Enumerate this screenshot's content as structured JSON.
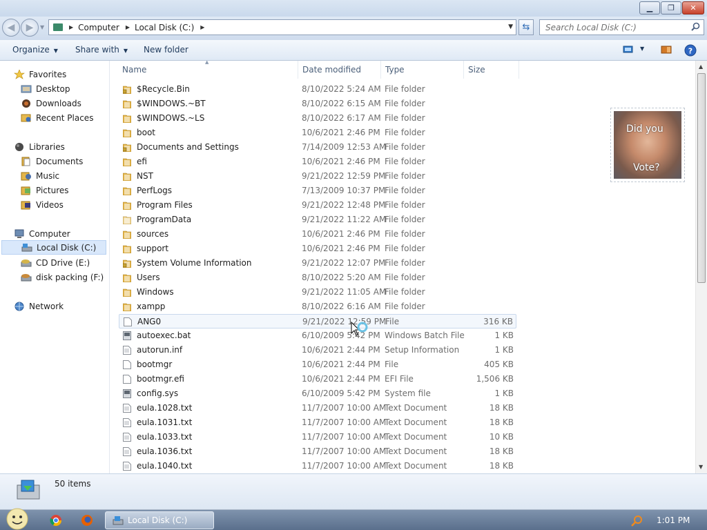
{
  "address": {
    "crumbs": [
      "Computer",
      "Local Disk (C:)"
    ]
  },
  "search": {
    "placeholder": "Search Local Disk (C:)"
  },
  "toolbar": {
    "organize_label": "Organize",
    "share_label": "Share with",
    "new_folder_label": "New folder"
  },
  "nav": {
    "favorites": "Favorites",
    "desktop": "Desktop",
    "downloads": "Downloads",
    "recent": "Recent Places",
    "libraries": "Libraries",
    "documents": "Documents",
    "music": "Music",
    "pictures": "Pictures",
    "videos": "Videos",
    "computer": "Computer",
    "local_disk": "Local Disk (C:)",
    "cd_drive": "CD Drive (E:)",
    "disk_packing": "disk packing (F:)",
    "network": "Network"
  },
  "columns": {
    "name": "Name",
    "date": "Date modified",
    "type": "Type",
    "size": "Size"
  },
  "files": [
    {
      "name": "$Recycle.Bin",
      "date": "8/10/2022 5:24 AM",
      "type": "File folder",
      "size": "",
      "kind": "folder-lock"
    },
    {
      "name": "$WINDOWS.~BT",
      "date": "8/10/2022 6:15 AM",
      "type": "File folder",
      "size": "",
      "kind": "folder"
    },
    {
      "name": "$WINDOWS.~LS",
      "date": "8/10/2022 6:17 AM",
      "type": "File folder",
      "size": "",
      "kind": "folder"
    },
    {
      "name": "boot",
      "date": "10/6/2021 2:46 PM",
      "type": "File folder",
      "size": "",
      "kind": "folder"
    },
    {
      "name": "Documents and Settings",
      "date": "7/14/2009 12:53 AM",
      "type": "File folder",
      "size": "",
      "kind": "folder-lock"
    },
    {
      "name": "efi",
      "date": "10/6/2021 2:46 PM",
      "type": "File folder",
      "size": "",
      "kind": "folder"
    },
    {
      "name": "NST",
      "date": "9/21/2022 12:59 PM",
      "type": "File folder",
      "size": "",
      "kind": "folder"
    },
    {
      "name": "PerfLogs",
      "date": "7/13/2009 10:37 PM",
      "type": "File folder",
      "size": "",
      "kind": "folder"
    },
    {
      "name": "Program Files",
      "date": "9/21/2022 12:48 PM",
      "type": "File folder",
      "size": "",
      "kind": "folder"
    },
    {
      "name": "ProgramData",
      "date": "9/21/2022 11:22 AM",
      "type": "File folder",
      "size": "",
      "kind": "folder-light"
    },
    {
      "name": "sources",
      "date": "10/6/2021 2:46 PM",
      "type": "File folder",
      "size": "",
      "kind": "folder"
    },
    {
      "name": "support",
      "date": "10/6/2021 2:46 PM",
      "type": "File folder",
      "size": "",
      "kind": "folder"
    },
    {
      "name": "System Volume Information",
      "date": "9/21/2022 12:07 PM",
      "type": "File folder",
      "size": "",
      "kind": "folder-lock"
    },
    {
      "name": "Users",
      "date": "8/10/2022 5:20 AM",
      "type": "File folder",
      "size": "",
      "kind": "folder"
    },
    {
      "name": "Windows",
      "date": "9/21/2022 11:05 AM",
      "type": "File folder",
      "size": "",
      "kind": "folder"
    },
    {
      "name": "xampp",
      "date": "8/10/2022 6:16 AM",
      "type": "File folder",
      "size": "",
      "kind": "folder"
    },
    {
      "name": "ANG0",
      "date": "9/21/2022 12:59 PM",
      "type": "File",
      "size": "316 KB",
      "kind": "file"
    },
    {
      "name": "autoexec.bat",
      "date": "6/10/2009 5:42 PM",
      "type": "Windows Batch File",
      "size": "1 KB",
      "kind": "bat"
    },
    {
      "name": "autorun.inf",
      "date": "10/6/2021 2:44 PM",
      "type": "Setup Information",
      "size": "1 KB",
      "kind": "text"
    },
    {
      "name": "bootmgr",
      "date": "10/6/2021 2:44 PM",
      "type": "File",
      "size": "405 KB",
      "kind": "file"
    },
    {
      "name": "bootmgr.efi",
      "date": "10/6/2021 2:44 PM",
      "type": "EFI File",
      "size": "1,506 KB",
      "kind": "file"
    },
    {
      "name": "config.sys",
      "date": "6/10/2009 5:42 PM",
      "type": "System file",
      "size": "1 KB",
      "kind": "sys"
    },
    {
      "name": "eula.1028.txt",
      "date": "11/7/2007 10:00 AM",
      "type": "Text Document",
      "size": "18 KB",
      "kind": "text"
    },
    {
      "name": "eula.1031.txt",
      "date": "11/7/2007 10:00 AM",
      "type": "Text Document",
      "size": "18 KB",
      "kind": "text"
    },
    {
      "name": "eula.1033.txt",
      "date": "11/7/2007 10:00 AM",
      "type": "Text Document",
      "size": "10 KB",
      "kind": "text"
    },
    {
      "name": "eula.1036.txt",
      "date": "11/7/2007 10:00 AM",
      "type": "Text Document",
      "size": "18 KB",
      "kind": "text"
    },
    {
      "name": "eula.1040.txt",
      "date": "11/7/2007 10:00 AM",
      "type": "Text Document",
      "size": "18 KB",
      "kind": "text"
    }
  ],
  "preview": {
    "line1": "Did you",
    "line2": "Vote?"
  },
  "status": {
    "item_count": "50 items"
  },
  "taskbar": {
    "window_label": "Local Disk (C:)",
    "clock": "1:01 PM"
  },
  "colors": {
    "folder": "#e3b54a",
    "selection": "#d9e8fb",
    "accent": "#1e395b"
  }
}
